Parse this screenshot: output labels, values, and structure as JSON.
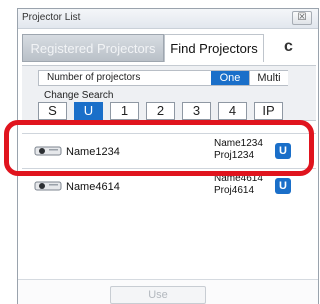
{
  "window": {
    "title": "Projector List",
    "close_label": "☒"
  },
  "tabs": {
    "registered": "Registered Projectors",
    "find": "Find Projectors",
    "refresh_icon": "refresh-icon",
    "refresh_glyph": "c"
  },
  "panel": {
    "number_label": "Number of projectors",
    "one": "One",
    "multi": "Multi",
    "change_search": "Change Search",
    "search_buttons": [
      "S",
      "U",
      "1",
      "2",
      "3",
      "4",
      "IP"
    ],
    "active_search": "U"
  },
  "projectors": [
    {
      "name": "Name1234",
      "info_name": "Name1234",
      "info_proj": "Proj1234",
      "badge": "U",
      "icon": "projector-icon"
    },
    {
      "name": "Name4614",
      "info_name": "Name4614",
      "info_proj": "Proj4614",
      "badge": "U",
      "icon": "projector-icon"
    }
  ],
  "footer": {
    "use": "Use"
  },
  "colors": {
    "accent": "#1a6fc9",
    "highlight": "#e0141e"
  }
}
